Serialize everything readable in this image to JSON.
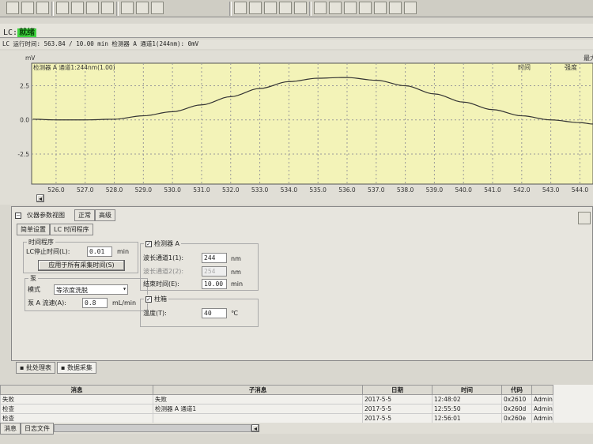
{
  "status": {
    "prefix": "LC:",
    "state": "就绪",
    "state_color": "#3fd33f"
  },
  "run_info": "LC 运行时间: 563.84 / 10.00 min 检测器 A 通道1(244nm): 0mV",
  "chart_data": {
    "type": "line",
    "ylabel": "mV",
    "trace_label": "检测器 A 通道1:244nm(1.00)",
    "right_headers": [
      "时间",
      "强度",
      "最大"
    ],
    "xlim": [
      525.16,
      544.45
    ],
    "ylim": [
      -4.7,
      4.15
    ],
    "xticks": [
      "526.0",
      "527.0",
      "528.0",
      "529.0",
      "530.0",
      "531.0",
      "532.0",
      "533.0",
      "534.0",
      "535.0",
      "536.0",
      "537.0",
      "538.0",
      "539.0",
      "540.0",
      "541.0",
      "542.0",
      "543.0",
      "544.0"
    ],
    "yticks": [
      "2.5",
      "0.0",
      "-2.5"
    ],
    "x": [
      525.2,
      526,
      527,
      528,
      529,
      530,
      531,
      532,
      533,
      534,
      535,
      535.8,
      536,
      537,
      538,
      539,
      540,
      541,
      542,
      543,
      544,
      544.45
    ],
    "y": [
      0.05,
      0,
      0,
      0.05,
      0.3,
      0.6,
      1.1,
      1.7,
      2.3,
      2.8,
      3.05,
      3.1,
      3.1,
      2.9,
      2.5,
      1.9,
      1.3,
      0.75,
      0.3,
      0,
      -0.2,
      -0.3
    ],
    "line_color": "#333333",
    "bg_color": "#f3f3b8",
    "grid": true
  },
  "panel": {
    "title": "仪器参数视图",
    "mode_tabs": [
      "正常",
      "高级"
    ],
    "sub_tabs": [
      "简单设置",
      "LC 时间程序"
    ],
    "time_program": {
      "title": "时间程序",
      "stop_label": "LC停止时间(L):",
      "stop_value": "0.01",
      "unit": "min",
      "apply_button": "应用于所有采集时间(S)"
    },
    "pump": {
      "title": "泵",
      "mode_label": "模式",
      "mode_value": "等浓度洗脱",
      "flow_label": "泵 A 流速(A):",
      "flow_value": "0.8",
      "flow_unit": "mL/min"
    },
    "detector": {
      "title": "检测器 A",
      "checked": true,
      "wl1_label": "波长通道1(1):",
      "wl1_value": "244",
      "wl2_label": "波长通道2(2):",
      "wl2_value": "254",
      "nm": "nm",
      "end_label": "结束时间(E):",
      "end_value": "10.00",
      "end_unit": "min"
    },
    "oven": {
      "title": "柱箱",
      "checked": true,
      "temp_label": "温度(T):",
      "temp_value": "40",
      "temp_unit": "℃"
    }
  },
  "bottom_tabs": [
    "批处理表",
    "数据采集"
  ],
  "messages": {
    "headers": [
      "消息",
      "子消息",
      "日期",
      "时间",
      "代码",
      ""
    ],
    "rows": [
      [
        "失败",
        "失败",
        "2017-5-5",
        "12:48:02",
        "0x2610",
        "Admin"
      ],
      [
        "检查",
        "检测器 A 通道1",
        "2017-5-5",
        "12:55:50",
        "0x260d",
        "Admin"
      ],
      [
        "检查",
        "",
        "2017-5-5",
        "12:56:01",
        "0x260e",
        "Admin"
      ]
    ],
    "tabs": [
      "消息",
      "日志文件"
    ]
  }
}
